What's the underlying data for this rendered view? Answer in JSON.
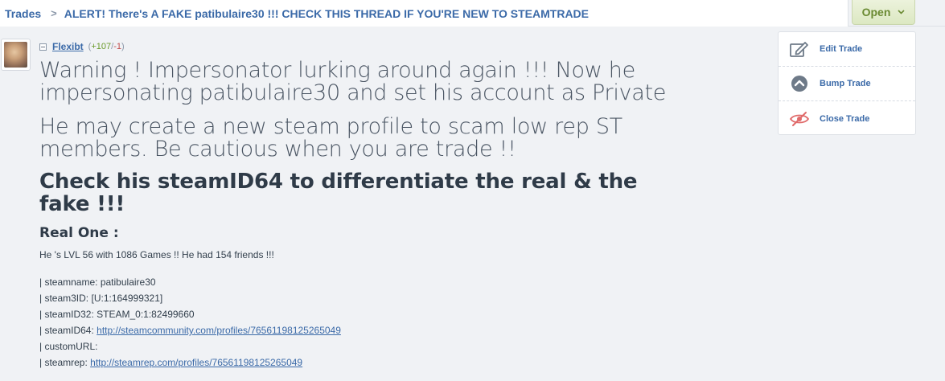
{
  "breadcrumb": {
    "root": "Trades",
    "separator": ">",
    "title": "ALERT! There's A FAKE patibulaire30 !!! CHECK THIS THREAD IF YOU'RE NEW TO STEAMTRADE"
  },
  "status_button": {
    "label": "Open",
    "chevron": "chevron-down-icon"
  },
  "post": {
    "username": "Flexibt",
    "rep_open": "(",
    "rep_positive": "+107",
    "rep_sep": "/",
    "rep_negative": "-1",
    "rep_close": ")",
    "warning_1": "Warning ! Impersonator lurking around again !!! Now he impersonating patibulaire30 and set his account as Private",
    "warning_2": "He may create a new steam profile to scam low rep ST members. Be cautious when you are trade !!",
    "heading": "Check his steamID64 to differentiate the real & the fake !!!",
    "subheading": "Real One :",
    "summary": "He 's LVL 56 with 1086 Games !! He had 154 friends !!!",
    "info": {
      "steamname_label": "| steamname: ",
      "steamname_value": "patibulaire30",
      "steam3id_label": "| steam3ID: ",
      "steam3id_value": "[U:1:164999321]",
      "steamid32_label": "| steamID32: ",
      "steamid32_value": "STEAM_0:1:82499660",
      "steamid64_label": "| steamID64: ",
      "steamid64_link": "http://steamcommunity.com/profiles/76561198125265049",
      "customurl_label": "| customURL:",
      "steamrep_label": "| steamrep: ",
      "steamrep_link": "http://steamrep.com/profiles/76561198125265049"
    }
  },
  "sidebar": {
    "items": [
      {
        "label": "Edit Trade",
        "icon": "edit-icon"
      },
      {
        "label": "Bump Trade",
        "icon": "bump-icon"
      },
      {
        "label": "Close Trade",
        "icon": "close-eye-icon"
      }
    ]
  },
  "colors": {
    "link": "#3b6aa8",
    "open_green": "#6a8a32",
    "rep_positive": "#6a9a2a",
    "rep_negative": "#c04b4b",
    "close_red": "#e06a6a"
  }
}
